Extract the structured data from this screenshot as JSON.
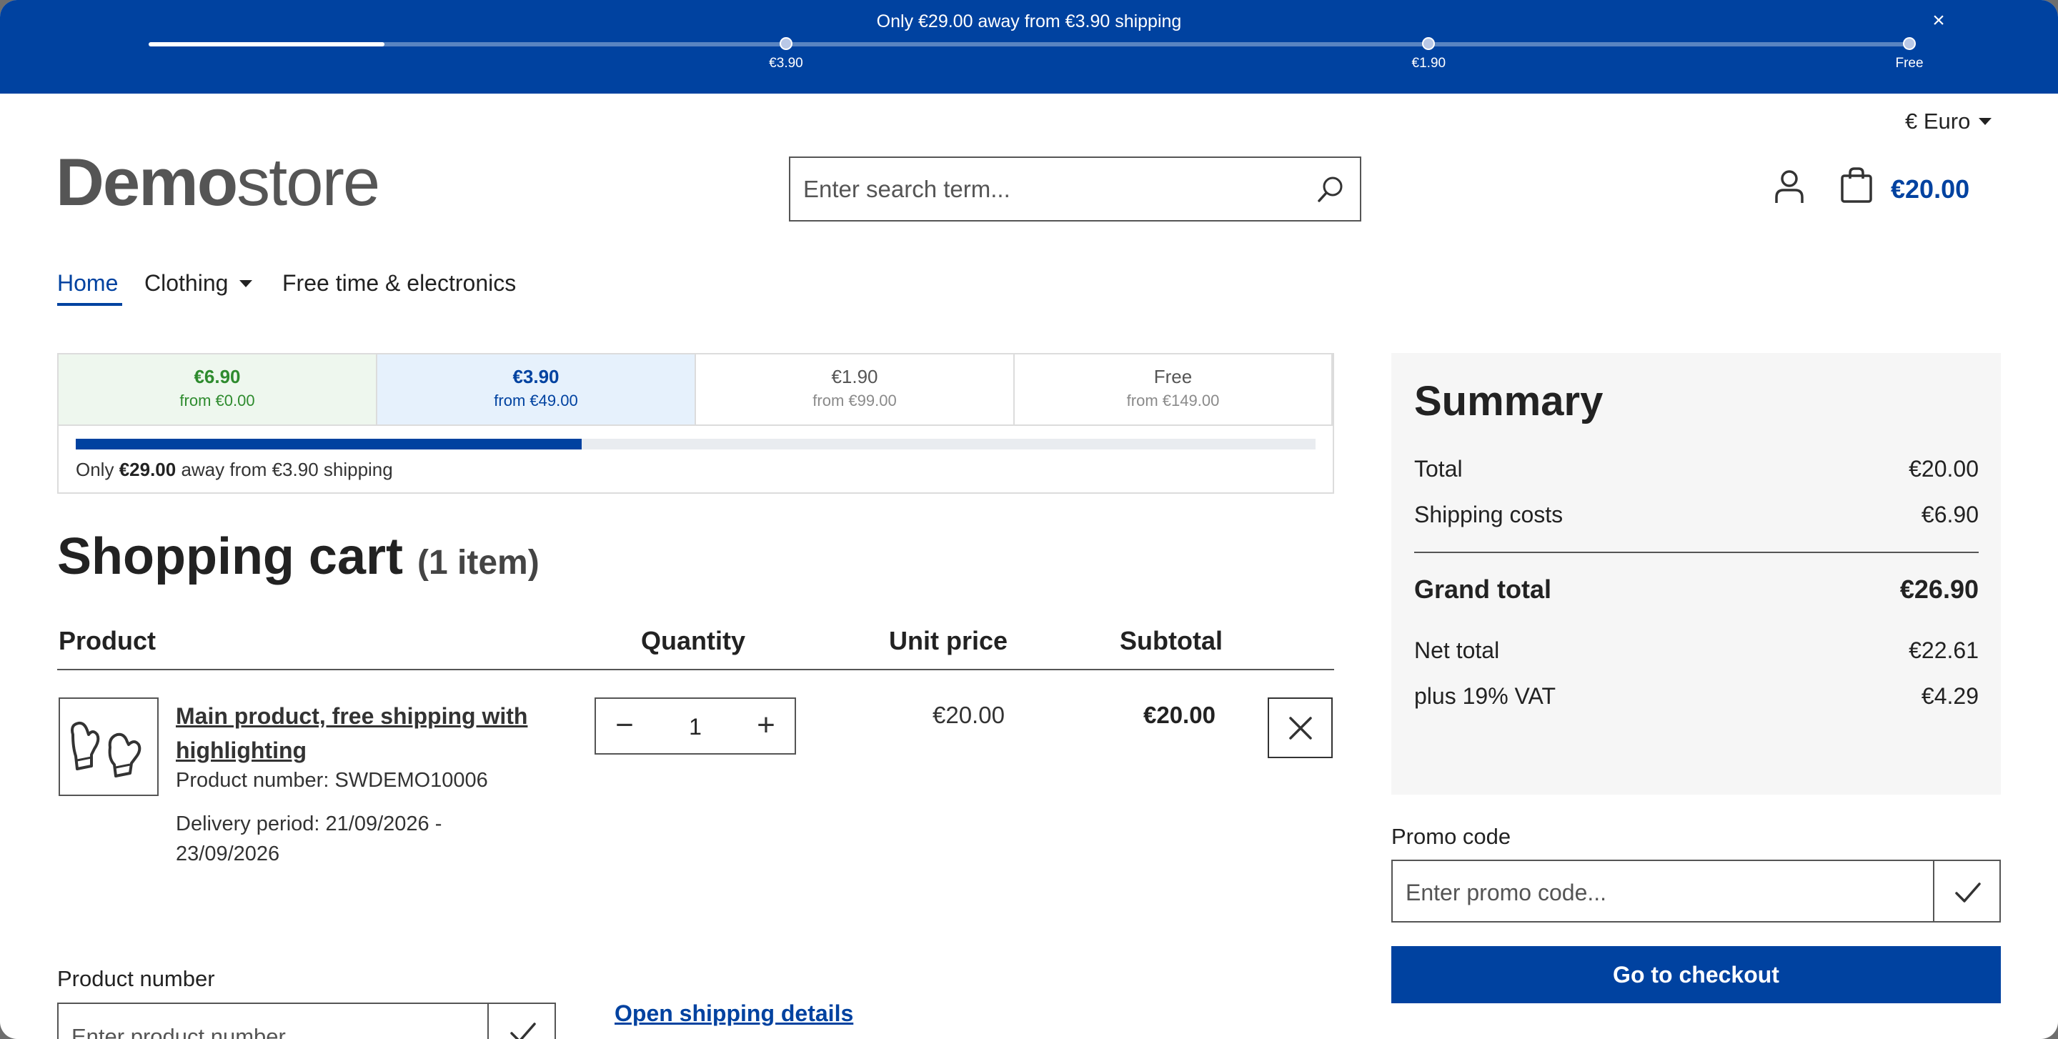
{
  "shipping_banner": {
    "message": "Only €29.00 away from €3.90 shipping",
    "progress_fraction": 0.134,
    "close_label": "×",
    "milestones": [
      {
        "label": "€3.90",
        "fraction": 0.362
      },
      {
        "label": "€1.90",
        "fraction": 0.727
      },
      {
        "label": "Free",
        "fraction": 1.0
      }
    ]
  },
  "header": {
    "currency": "€ Euro",
    "logo_bold": "Demo",
    "logo_regular": "store",
    "search_placeholder": "Enter search term...",
    "cart_total": "€20.00"
  },
  "nav": {
    "items": [
      {
        "label": "Home",
        "active": true
      },
      {
        "label": "Clothing",
        "has_dropdown": true
      },
      {
        "label": "Free time & electronics"
      }
    ]
  },
  "shipping_tiers": {
    "tiers": [
      {
        "price": "€6.90",
        "from": "from €0.00",
        "state": "current"
      },
      {
        "price": "€3.90",
        "from": "from €49.00",
        "state": "next"
      },
      {
        "price": "€1.90",
        "from": "from €99.00",
        "state": "inactive"
      },
      {
        "price": "Free",
        "from": "from €149.00",
        "state": "inactive"
      }
    ],
    "progress_fraction": 0.408,
    "message_prefix": "Only ",
    "message_amount": "€29.00",
    "message_suffix": " away from €3.90 shipping"
  },
  "cart": {
    "title": "Shopping cart",
    "count_label": "(1 item)",
    "columns": {
      "product": "Product",
      "quantity": "Quantity",
      "unit_price": "Unit price",
      "subtotal": "Subtotal"
    },
    "items": [
      {
        "name": "Main product, free shipping with highlighting",
        "product_number": "Product number: SWDEMO10006",
        "delivery": "Delivery period: 21/09/2026 - 23/09/2026",
        "quantity": "1",
        "unit_price": "€20.00",
        "subtotal": "€20.00",
        "thumbnail_icon": "mittens-icon"
      }
    ],
    "qty_minus": "−",
    "qty_plus": "+",
    "product_number_label": "Product number",
    "product_number_placeholder": "Enter product number...",
    "shipping_details_link": "Open shipping details"
  },
  "summary": {
    "title": "Summary",
    "rows": [
      {
        "label": "Total",
        "value": "€20.00"
      },
      {
        "label": "Shipping costs",
        "value": "€6.90"
      }
    ],
    "grand_total": {
      "label": "Grand total",
      "value": "€26.90"
    },
    "tax_rows": [
      {
        "label": "Net total",
        "value": "€22.61"
      },
      {
        "label": "plus 19% VAT",
        "value": "€4.29"
      }
    ],
    "promo_label": "Promo code",
    "promo_placeholder": "Enter promo code...",
    "checkout_label": "Go to checkout"
  },
  "colors": {
    "brand_blue": "#0042a0",
    "tier_current_bg": "#eef7ee",
    "tier_current_text": "#2e8b2e",
    "tier_next_bg": "#e6f1fc",
    "tier_inactive_text": "#555555"
  }
}
